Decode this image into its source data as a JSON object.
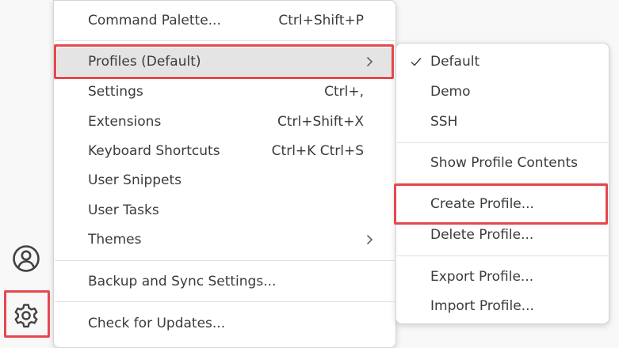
{
  "activity_bar": {
    "accounts_icon": "account-circle-icon",
    "manage_icon": "gear-icon"
  },
  "main_menu": {
    "items": [
      {
        "label": "Command Palette...",
        "keybinding": "Ctrl+Shift+P"
      },
      {
        "label": "Profiles (Default)",
        "keybinding": ""
      },
      {
        "label": "Settings",
        "keybinding": "Ctrl+,"
      },
      {
        "label": "Extensions",
        "keybinding": "Ctrl+Shift+X"
      },
      {
        "label": "Keyboard Shortcuts",
        "keybinding": "Ctrl+K Ctrl+S"
      },
      {
        "label": "User Snippets",
        "keybinding": ""
      },
      {
        "label": "User Tasks",
        "keybinding": ""
      },
      {
        "label": "Themes",
        "keybinding": ""
      },
      {
        "label": "Backup and Sync Settings...",
        "keybinding": ""
      },
      {
        "label": "Check for Updates...",
        "keybinding": ""
      }
    ],
    "chevron_icon": "chevron-right-icon"
  },
  "profiles_submenu": {
    "items": [
      {
        "label": "Default",
        "checked": true
      },
      {
        "label": "Demo"
      },
      {
        "label": "SSH"
      },
      {
        "label": "Show Profile Contents"
      },
      {
        "label": "Create Profile..."
      },
      {
        "label": "Delete Profile..."
      },
      {
        "label": "Export Profile..."
      },
      {
        "label": "Import Profile..."
      }
    ],
    "check_icon": "checkmark-icon"
  },
  "colors": {
    "highlight": "#e4e4e4",
    "annotation": "#e5484d",
    "text": "#3b3b3b"
  }
}
